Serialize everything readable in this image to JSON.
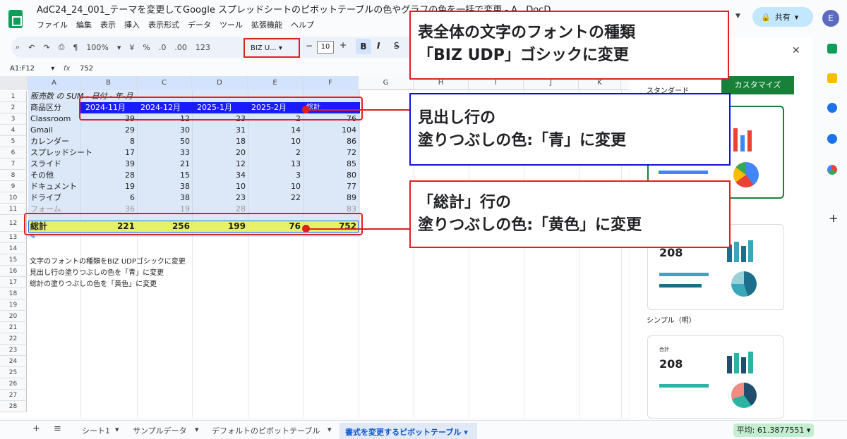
{
  "app": {
    "title": "AdC24_24_001_テーマを変更してGoogle スプレッドシートのピボットテーブルの色やグラフの色を一括で変更 - A...DocD...",
    "menu": [
      "ファイル",
      "編集",
      "表示",
      "挿入",
      "表示形式",
      "データ",
      "ツール",
      "拡張機能",
      "ヘルプ"
    ],
    "share_label": "共有",
    "avatar_letter": "E"
  },
  "toolbar": {
    "zoom": "100%",
    "currency": "¥",
    "percent": "%",
    "dec_less": ".0",
    "dec_more": ".00",
    "number_fmt": "123",
    "font": "BIZ U...",
    "font_size": "10",
    "bold": "B",
    "italic": "I"
  },
  "formula_bar": {
    "range": "A1:F12",
    "fx": "fx",
    "value": "752"
  },
  "columns": [
    "A",
    "B",
    "C",
    "D",
    "E",
    "F",
    "G",
    "H",
    "I",
    "J",
    "K"
  ],
  "rows": [
    "1",
    "2",
    "3",
    "4",
    "5",
    "6",
    "7",
    "8",
    "9",
    "10",
    "11",
    "12",
    "13",
    "14",
    "15",
    "16",
    "17",
    "18",
    "19",
    "20",
    "21",
    "22",
    "23",
    "24",
    "25",
    "26",
    "27",
    "28"
  ],
  "pivot": {
    "title_row": "販売数 の SUM - 日付 - 年-月",
    "header": {
      "label": "商品区分",
      "cols": [
        "2024-11月",
        "2024-12月",
        "2025-1月",
        "2025-2月",
        "総計"
      ]
    },
    "data": [
      {
        "name": "Classroom",
        "v": [
          "39",
          "12",
          "23",
          "2",
          "76"
        ]
      },
      {
        "name": "Gmail",
        "v": [
          "29",
          "30",
          "31",
          "14",
          "104"
        ]
      },
      {
        "name": "カレンダー",
        "v": [
          "8",
          "50",
          "18",
          "10",
          "86"
        ]
      },
      {
        "name": "スプレッドシート",
        "v": [
          "17",
          "33",
          "20",
          "2",
          "72"
        ]
      },
      {
        "name": "スライド",
        "v": [
          "39",
          "21",
          "12",
          "13",
          "85"
        ]
      },
      {
        "name": "その他",
        "v": [
          "28",
          "15",
          "34",
          "3",
          "80"
        ]
      },
      {
        "name": "ドキュメント",
        "v": [
          "19",
          "38",
          "10",
          "10",
          "77"
        ]
      },
      {
        "name": "ドライブ",
        "v": [
          "6",
          "38",
          "23",
          "22",
          "89"
        ]
      },
      {
        "name": "フォーム",
        "v": [
          "36",
          "19",
          "28",
          "",
          "83"
        ]
      }
    ],
    "total": {
      "name": "総計",
      "v": [
        "221",
        "256",
        "199",
        "76",
        "752"
      ]
    }
  },
  "notes": [
    "文字のフォントの種類をBIZ UDPゴシックに変更",
    "見出し行の塗りつぶしの色を「青」に変更",
    "総計の塗りつぶしの色を「黄色」に変更"
  ],
  "callouts": {
    "font": [
      "表全体の文字のフォントの種類",
      "「BIZ UDP」ゴシックに変更"
    ],
    "header": [
      "見出し行の",
      "塗りつぶしの色:「青」に変更"
    ],
    "total": [
      "「総計」行の",
      "塗りつぶしの色:「黄色」に変更"
    ]
  },
  "panel": {
    "theme_label": "スタンダード",
    "customize": "カスタマイズ",
    "theme_simple": "シンプル（明）",
    "card_value": "208",
    "card_label": "合計"
  },
  "sheets": {
    "add": "+",
    "list": "≡",
    "tabs": [
      "シート1",
      "サンプルデータ",
      "デフォルトのピボットテーブル"
    ],
    "active": "書式を変更するピボットテーブル",
    "avg": "平均: 61.3877551"
  },
  "colors": {
    "accent_red": "#e0201f",
    "header_blue": "#1a1aff",
    "total_yellow": "#e6f168"
  }
}
